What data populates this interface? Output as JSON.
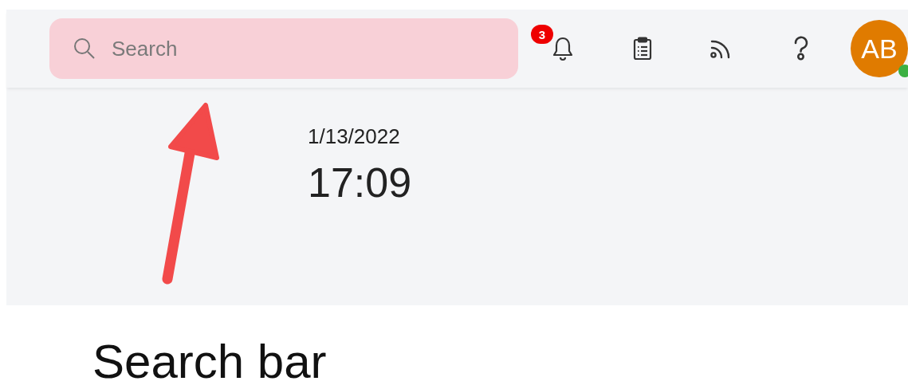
{
  "search": {
    "placeholder": "Search"
  },
  "notifications": {
    "count": "3"
  },
  "toolbar": [
    {
      "kind": "clipboard"
    },
    {
      "kind": "feed"
    },
    {
      "kind": "help"
    }
  ],
  "user": {
    "initials": "AB",
    "online": true
  },
  "datetime": {
    "date": "1/13/2022",
    "time": "17:09"
  },
  "caption": "Search bar"
}
